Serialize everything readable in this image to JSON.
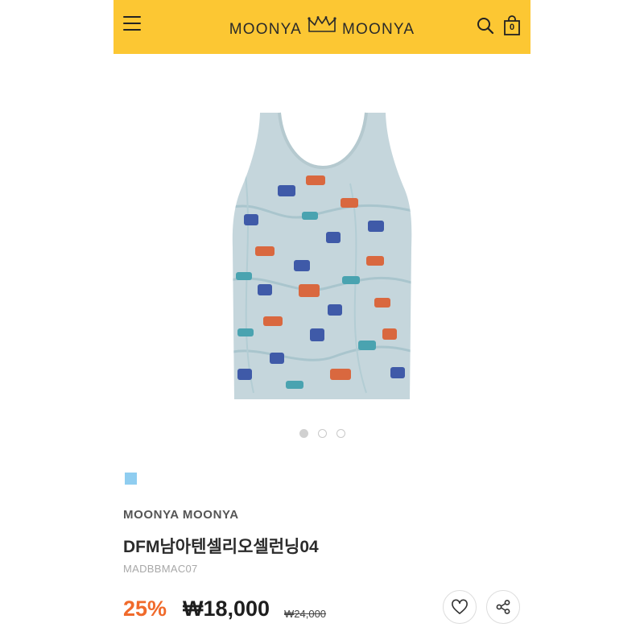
{
  "header": {
    "logo_left": "MOONYA",
    "logo_right": "MOONYA",
    "menu_icon": "hamburger-menu-icon",
    "search_icon": "search-icon",
    "cart_icon": "shopping-bag-icon",
    "cart_count": "0",
    "background_color": "#fcc733"
  },
  "gallery": {
    "image_count": 3,
    "active_index": 0
  },
  "product": {
    "color_swatch": "#8fcdf0",
    "brand": "MOONYA MOONYA",
    "name": "DFM남아텐셀리오셀런닝04",
    "code": "MADBBMAC07",
    "discount": "25%",
    "price": "₩18,000",
    "original_price": "₩24,000",
    "discount_color": "#f06a2b"
  },
  "actions": {
    "like_icon": "heart-icon",
    "share_icon": "share-icon"
  }
}
